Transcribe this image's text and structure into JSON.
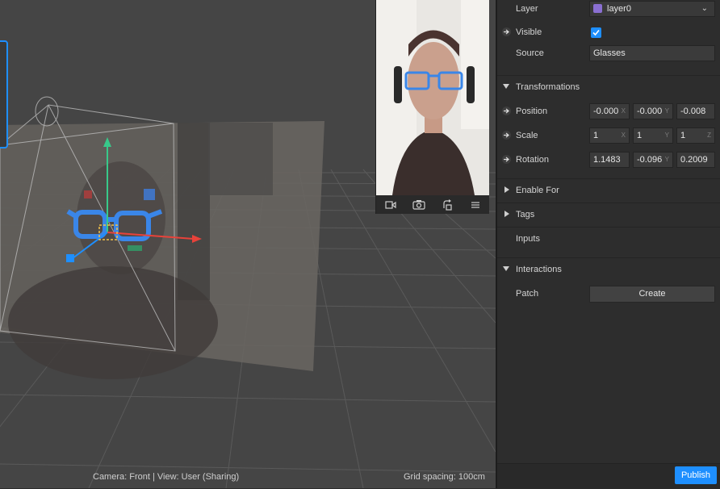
{
  "viewport": {
    "status_camera": "Camera: Front | View: User (Sharing)",
    "status_grid": "Grid spacing: 100cm"
  },
  "preview": {
    "controls": [
      "camera-icon",
      "switch-camera-icon",
      "rotate-icon",
      "menu-icon"
    ]
  },
  "panel": {
    "layer": {
      "label": "Layer",
      "value": "layer0",
      "swatch_color": "#8a6fd1"
    },
    "visible": {
      "label": "Visible",
      "checked": true
    },
    "source": {
      "label": "Source",
      "value": "Glasses"
    },
    "transformations": {
      "label": "Transformations",
      "position": {
        "label": "Position",
        "x": "-0.000",
        "y": "-0.000",
        "z": "-0.008"
      },
      "scale": {
        "label": "Scale",
        "x": "1",
        "y": "1",
        "z": "1"
      },
      "rotation": {
        "label": "Rotation",
        "x": "1.1483",
        "y": "-0.096",
        "z": "0.2009"
      }
    },
    "axis_labels": {
      "x": "X",
      "y": "Y",
      "z": "Z"
    },
    "enable_for": "Enable For",
    "tags": "Tags",
    "inputs": "Inputs",
    "interactions": "Interactions",
    "patch": {
      "label": "Patch",
      "button": "Create"
    },
    "publish": "Publish"
  },
  "colors": {
    "accent": "#1e8fff",
    "gizmo_x": "#e8423a",
    "gizmo_y": "#38c98a",
    "gizmo_z": "#1e8fff",
    "glasses": "#3a86e8"
  }
}
